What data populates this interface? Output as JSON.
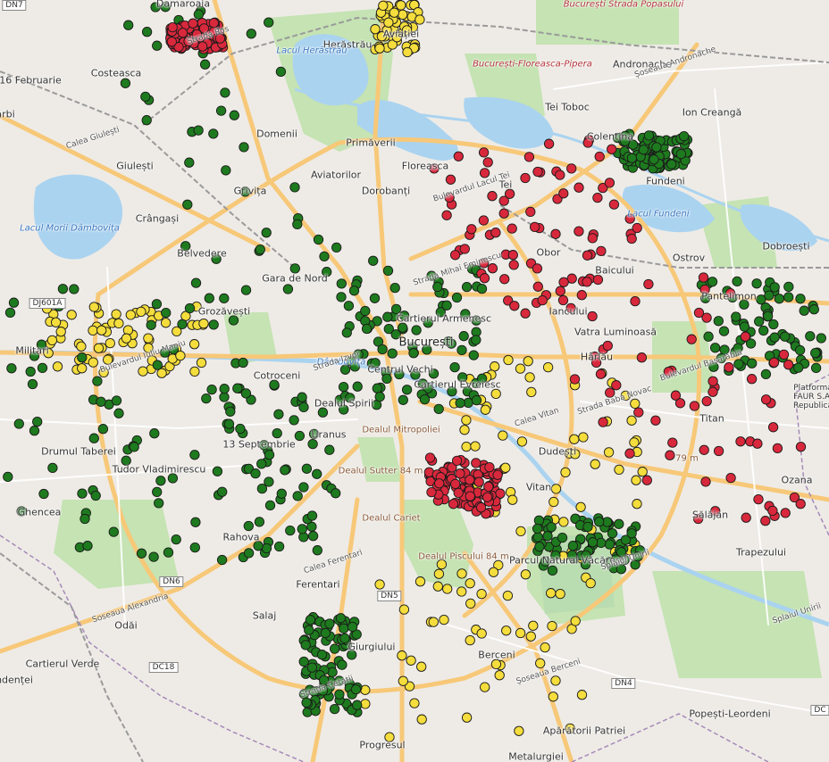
{
  "map": {
    "labels": [
      {
        "id": "damaroaia",
        "text": "Damaroaia"
      },
      {
        "id": "costeasca",
        "text": "Costeasca"
      },
      {
        "id": "feb16",
        "text": "16 Februarie"
      },
      {
        "id": "arbi",
        "text": "ărbi"
      },
      {
        "id": "giulesti",
        "text": "Giulești"
      },
      {
        "id": "crangasi",
        "text": "Crângași"
      },
      {
        "id": "belvedere",
        "text": "Belvedere"
      },
      {
        "id": "grozavesti",
        "text": "Grozăvești"
      },
      {
        "id": "militari",
        "text": "Militari"
      },
      {
        "id": "drumul_taberei",
        "text": "Drumul Taberei"
      },
      {
        "id": "tudor",
        "text": "Tudor Vladimirescu"
      },
      {
        "id": "ghencea",
        "text": "Ghencea"
      },
      {
        "id": "rahova",
        "text": "Rahova"
      },
      {
        "id": "sept13",
        "text": "13 Septembrie"
      },
      {
        "id": "cotroceni",
        "text": "Cotroceni"
      },
      {
        "id": "herastrau",
        "text": "Herăstrău"
      },
      {
        "id": "aviatiei",
        "text": "Aviației"
      },
      {
        "id": "andronache",
        "text": "Andronache"
      },
      {
        "id": "tei_toboc",
        "text": "Tei Toboc"
      },
      {
        "id": "ion_creanga",
        "text": "Ion Creangă"
      },
      {
        "id": "domenii",
        "text": "Domenii"
      },
      {
        "id": "primaverii",
        "text": "Primăverii"
      },
      {
        "id": "aviatorilor",
        "text": "Aviatorilor"
      },
      {
        "id": "floreasca",
        "text": "Floreasca"
      },
      {
        "id": "tei",
        "text": "Tei"
      },
      {
        "id": "colentina",
        "text": "Colentina"
      },
      {
        "id": "fundeni",
        "text": "Fundeni"
      },
      {
        "id": "dobroesti",
        "text": "Dobroești"
      },
      {
        "id": "grivita",
        "text": "Grivița"
      },
      {
        "id": "dorobanti",
        "text": "Dorobanți"
      },
      {
        "id": "obor",
        "text": "Obor"
      },
      {
        "id": "ostrov",
        "text": "Ostrov"
      },
      {
        "id": "gara_nord",
        "text": "Gara de Nord"
      },
      {
        "id": "cartierul_armenesc",
        "text": "Cartierul Armenesc"
      },
      {
        "id": "bucuresti",
        "text": "București"
      },
      {
        "id": "baicului",
        "text": "Baicului"
      },
      {
        "id": "pantelimon",
        "text": "Pantelimon"
      },
      {
        "id": "vatra",
        "text": "Vatra Luminoasă"
      },
      {
        "id": "iancului",
        "text": "Iancului"
      },
      {
        "id": "centrul_vechi",
        "text": "Centrul Vechi"
      },
      {
        "id": "cartierul_evreiesc",
        "text": "Cartierul Evreiesc"
      },
      {
        "id": "harlau",
        "text": "Hârlău"
      },
      {
        "id": "dealul_spirii",
        "text": "Dealul Spirii"
      },
      {
        "id": "uranus",
        "text": "Uranus"
      },
      {
        "id": "titan",
        "text": "Titan"
      },
      {
        "id": "dudesti",
        "text": "Dudești"
      },
      {
        "id": "vitan",
        "text": "Vitan"
      },
      {
        "id": "ozana",
        "text": "Ozana"
      },
      {
        "id": "salajan",
        "text": "Sălăjan"
      },
      {
        "id": "trapezului",
        "text": "Trapezului"
      },
      {
        "id": "ferentari",
        "text": "Ferentari"
      },
      {
        "id": "salaj",
        "text": "Salaj"
      },
      {
        "id": "odai",
        "text": "Odăi"
      },
      {
        "id": "cartierul_verde",
        "text": "Cartierul Verde"
      },
      {
        "id": "ndentei",
        "text": "ndenței"
      },
      {
        "id": "giurgiului",
        "text": "Giurgiului"
      },
      {
        "id": "berceni",
        "text": "Berceni"
      },
      {
        "id": "aparatorii",
        "text": "Apărătorii Patriei"
      },
      {
        "id": "progresul",
        "text": "Progresul"
      },
      {
        "id": "metalurgiei",
        "text": "Metalurgiei"
      },
      {
        "id": "popesti",
        "text": "Popești-Leordeni"
      },
      {
        "id": "platforma",
        "text": "Platforma FAUR S.A. Republica"
      },
      {
        "id": "parcul_vacaresti",
        "text": "Parcul Natural Văcărești"
      }
    ],
    "water_labels": [
      {
        "id": "lacul_morii",
        "text": "Lacul Morii Dâmbovița"
      },
      {
        "id": "lacul_herastrau",
        "text": "Lacul Herăstrău"
      },
      {
        "id": "lacul_fundeni",
        "text": "Lacul Fundeni"
      },
      {
        "id": "dambovita",
        "text": "Dâmbovița"
      }
    ],
    "rail_labels": [
      {
        "id": "popasului",
        "text": "București Strada Popasului"
      },
      {
        "id": "floreasca_pipera",
        "text": "București-Floreasca-Pipera"
      }
    ],
    "elevation_labels": [
      {
        "id": "dealul_mitropoliei",
        "text": "Dealul Mitropoliei"
      },
      {
        "id": "dealul_sutter",
        "text": "Dealul Sutter 84 m"
      },
      {
        "id": "dealul_piscului",
        "text": "Dealul Piscului 84 m"
      },
      {
        "id": "dealul_cariet",
        "text": "Dealul Cariet"
      },
      {
        "id": "m79",
        "text": "79 m"
      }
    ],
    "road_labels": [
      {
        "id": "calea_giulesti",
        "text": "Calea Giulești"
      },
      {
        "id": "strada_mihai_eminescu",
        "text": "Strada Mihai Eminescu"
      },
      {
        "id": "splaiul_unirii",
        "text": "Splaiul Unirii"
      },
      {
        "id": "splaiul_unirii2",
        "text": "Splaiul Unirii"
      },
      {
        "id": "soseaua_alexandria",
        "text": "Soseaua Alexandria"
      },
      {
        "id": "soseaua_andronache",
        "text": "Șoseaua Andronache"
      },
      {
        "id": "calea_ferentari",
        "text": "Calea Ferentari"
      },
      {
        "id": "strada_izvor",
        "text": "Strada Izvor"
      },
      {
        "id": "bd_basarabia",
        "text": "Bulevardul Basarabia"
      },
      {
        "id": "bd_iuliu_maniu",
        "text": "Bulevardul Iuliu Maniu"
      },
      {
        "id": "strada_rosu",
        "text": "Strada Ros"
      },
      {
        "id": "soseaua_berceni",
        "text": "Șoseaua Berceni"
      },
      {
        "id": "bd_tei",
        "text": "Bulevardul Lacul Tei"
      },
      {
        "id": "calea_vitan",
        "text": "Calea Vitan"
      },
      {
        "id": "strada_cetatii",
        "text": "Strada Cetatii"
      },
      {
        "id": "strada_baba",
        "text": "Strada Baba Novac"
      }
    ],
    "road_shields": [
      {
        "id": "n7",
        "text": "DN7"
      },
      {
        "id": "dj601a",
        "text": "DJ601A"
      },
      {
        "id": "dn6",
        "text": "DN6"
      },
      {
        "id": "dc18",
        "text": "DC18"
      },
      {
        "id": "dn5",
        "text": "DN5"
      },
      {
        "id": "dn4",
        "text": "DN4"
      },
      {
        "id": "dc",
        "text": "DC"
      }
    ],
    "markers": {
      "colors": {
        "green": "#1e7a1e",
        "yellow": "#f4dd3c",
        "red": "#d8283c"
      },
      "green_count": 620,
      "yellow_count": 250,
      "red_count": 360
    }
  }
}
